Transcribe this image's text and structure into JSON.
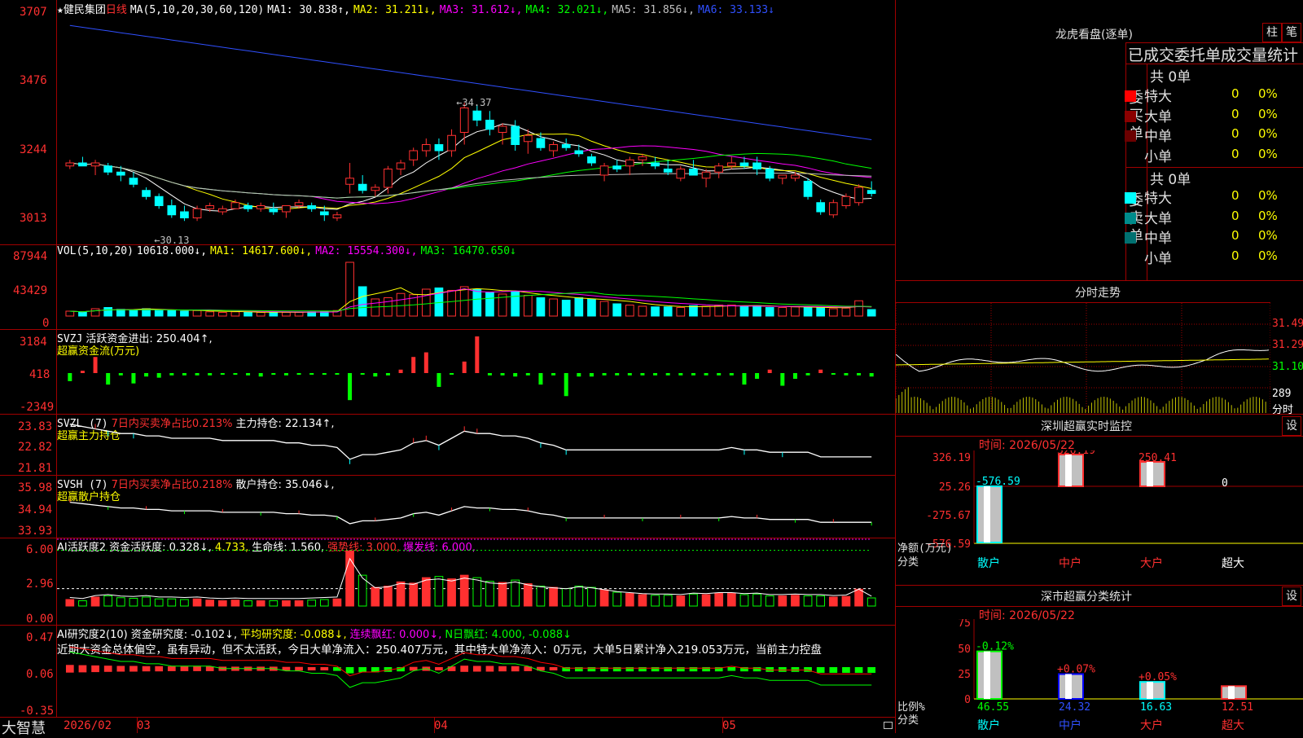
{
  "main_chart": {
    "star": "★",
    "stock_name": "健民集团",
    "period": "日线",
    "ma_params": "MA(5,10,20,30,60,120)",
    "ma1": "MA1: 30.838↑,",
    "ma2": "MA2: 31.211↓,",
    "ma3": "MA3: 31.612↓,",
    "ma4": "MA4: 32.021↓,",
    "ma5": "MA5: 31.856↓,",
    "ma6": "MA6: 33.133↓",
    "y_labels": [
      "3707",
      "3476",
      "3244",
      "3013"
    ],
    "high_mark": "34.37",
    "low_mark": "30.13"
  },
  "vol_panel": {
    "title": "VOL(5,10,20)",
    "value": "10618.000↓,",
    "ma1": "MA1: 14617.600↓,",
    "ma2": "MA2: 15554.300↓,",
    "ma3": "MA3: 16470.650↓",
    "y_labels": [
      "87944",
      "43429",
      "0"
    ]
  },
  "svzj_panel": {
    "title": "SVZJ",
    "desc": "活跃资金进出: 250.404↑,",
    "sub": "超赢资金流(万元)",
    "y_labels": [
      "3184",
      "418",
      "-2349"
    ]
  },
  "svzl_panel": {
    "title": "SVZL (7)",
    "desc": "7日内买卖净占比0.213%",
    "hold": "主力持仓: 22.134↑,",
    "sub": "超赢主力持仓",
    "y_labels": [
      "23.83",
      "22.82",
      "21.81"
    ]
  },
  "svsh_panel": {
    "title": "SVSH (7)",
    "desc": "7日内买卖净占比0.218%",
    "hold": "散户持仓: 35.046↓,",
    "sub": "超赢散户持仓",
    "y_labels": [
      "35.98",
      "34.94",
      "33.93"
    ]
  },
  "ai_active_panel": {
    "title": "AI活跃度2 资金活跃度: 0.328↓,",
    "v2": "4.733,",
    "life": "生命线: 1.560,",
    "strong": "强势线: 3.000,",
    "burst": "爆发线: 6.000,",
    "y_labels": [
      "6.00",
      "2.96",
      "0.00"
    ]
  },
  "ai_research_panel": {
    "title": "AI研究度2(10)",
    "fund": "资金研究度: -0.102↓,",
    "avg": "平均研究度: -0.088↓,",
    "cont": "连续飘红: 0.000↓,",
    "ndays": "N日飘红: 4.000, -0.088↓",
    "comment": "近期大资金总体偏空，虽有异动，但不太活跃，今日大单净流入：250.407万元，其中特大单净流入：0万元，大单5日累计净入219.053万元，当前主力控盘",
    "y_labels": [
      "0.47",
      "0.06",
      "-0.35"
    ]
  },
  "bottom_bar": {
    "brand": "大智慧",
    "dates": [
      "2026/02",
      "03",
      "04",
      "05"
    ]
  },
  "dragon_tiger": {
    "title": "龙虎看盘(逐单)",
    "btn_bar": "柱",
    "btn_tick": "笔",
    "stats_title": "已成交委托单成交量统计",
    "buy_label": "委买单",
    "sell_label": "委卖单",
    "buy_total": "共 0单",
    "sell_total": "共 0单",
    "buy_rows": [
      {
        "label": "特大",
        "count": "0",
        "pct": "0%",
        "color": "#ff0000"
      },
      {
        "label": "大单",
        "count": "0",
        "pct": "0%",
        "color": "#8b0000"
      },
      {
        "label": "中单",
        "count": "0",
        "pct": "0%",
        "color": "#6b0000"
      },
      {
        "label": "小单",
        "count": "0",
        "pct": "0%",
        "color": ""
      }
    ],
    "sell_rows": [
      {
        "label": "特大",
        "count": "0",
        "pct": "0%",
        "color": "#00ffff"
      },
      {
        "label": "大单",
        "count": "0",
        "pct": "0%",
        "color": "#008b8b"
      },
      {
        "label": "中单",
        "count": "0",
        "pct": "0%",
        "color": "#007070"
      },
      {
        "label": "小单",
        "count": "0",
        "pct": "0%",
        "color": ""
      }
    ]
  },
  "intraday": {
    "title": "分时走势",
    "price_labels": [
      "31.49",
      "31.29",
      "31.10"
    ],
    "vol_labels": [
      "289",
      "分时"
    ]
  },
  "sz_monitor": {
    "title": "深圳超赢实时监控",
    "btn": "设",
    "time": "时间: 2026/05/22",
    "y_labels": [
      "326.19",
      "25.26",
      "-275.67",
      "-576.59"
    ],
    "values": [
      "-576.59",
      "326.19",
      "250.41",
      "0"
    ],
    "axis_label": "净额(万元)",
    "cat_label": "分类",
    "cats": [
      "散户",
      "中户",
      "大户",
      "超大"
    ]
  },
  "sz_classify": {
    "title": "深市超赢分类统计",
    "btn": "设",
    "time": "时间: 2026/05/22",
    "y_labels": [
      "75",
      "50",
      "25",
      "0"
    ],
    "pct_labels": [
      "-0.12%",
      "+0.07%",
      "+0.05%",
      ""
    ],
    "values": [
      "46.55",
      "24.32",
      "16.63",
      "12.51"
    ],
    "axis_label": "比例%",
    "cat_label": "分类",
    "cats": [
      "散户",
      "中户",
      "大户",
      "超大"
    ]
  },
  "colors": {
    "up": "#ff3030",
    "down": "#00ffff",
    "ma1": "#ffffff",
    "ma2": "#ffff00",
    "ma3": "#ff00ff",
    "ma4": "#00ff00",
    "ma5": "#c0c0c0",
    "ma6": "#3050ff"
  },
  "chart_data": {
    "type": "candlestick",
    "title": "健民集团 日线",
    "x_labels": [
      "2026/02",
      "03",
      "04",
      "05"
    ],
    "ylim": [
      30.13,
      37.07
    ],
    "ohlc": [
      [
        32.3,
        32.5,
        32.2,
        32.4
      ],
      [
        32.4,
        32.6,
        32.3,
        32.3
      ],
      [
        32.3,
        32.5,
        32.0,
        32.4
      ],
      [
        32.3,
        32.4,
        32.0,
        32.1
      ],
      [
        32.1,
        32.3,
        31.8,
        32.0
      ],
      [
        31.9,
        32.1,
        31.6,
        31.7
      ],
      [
        31.5,
        31.6,
        31.2,
        31.3
      ],
      [
        31.3,
        31.4,
        30.9,
        31.0
      ],
      [
        31.0,
        31.2,
        30.6,
        30.7
      ],
      [
        30.8,
        31.0,
        30.5,
        30.6
      ],
      [
        30.6,
        31.0,
        30.5,
        30.9
      ],
      [
        30.9,
        31.1,
        30.8,
        31.0
      ],
      [
        30.8,
        31.0,
        30.7,
        30.9
      ],
      [
        30.9,
        31.2,
        30.9,
        31.1
      ],
      [
        31.0,
        31.1,
        30.8,
        30.9
      ],
      [
        30.9,
        31.1,
        30.8,
        31.0
      ],
      [
        30.9,
        31.1,
        30.7,
        30.8
      ],
      [
        30.8,
        31.0,
        30.6,
        31.0
      ],
      [
        31.0,
        31.2,
        30.9,
        31.1
      ],
      [
        31.0,
        31.1,
        30.8,
        30.9
      ],
      [
        30.8,
        31.0,
        30.5,
        30.7
      ],
      [
        30.6,
        30.8,
        30.5,
        30.7
      ],
      [
        31.7,
        32.4,
        31.4,
        31.9
      ],
      [
        31.7,
        32.0,
        31.4,
        31.5
      ],
      [
        31.5,
        31.7,
        31.3,
        31.6
      ],
      [
        31.6,
        32.3,
        31.4,
        32.2
      ],
      [
        32.2,
        32.5,
        32.0,
        32.4
      ],
      [
        32.5,
        32.9,
        32.3,
        32.8
      ],
      [
        32.8,
        33.2,
        32.6,
        33.0
      ],
      [
        33.0,
        33.2,
        32.5,
        32.8
      ],
      [
        32.8,
        33.5,
        32.6,
        33.3
      ],
      [
        33.4,
        34.37,
        33.0,
        34.2
      ],
      [
        34.1,
        34.3,
        33.6,
        33.8
      ],
      [
        33.8,
        34.1,
        33.3,
        33.5
      ],
      [
        33.4,
        33.7,
        33.0,
        33.6
      ],
      [
        33.6,
        33.8,
        32.8,
        33.0
      ],
      [
        33.1,
        33.5,
        32.7,
        33.3
      ],
      [
        33.2,
        33.4,
        32.8,
        32.9
      ],
      [
        32.8,
        33.1,
        32.6,
        33.0
      ],
      [
        33.0,
        33.2,
        32.8,
        32.9
      ],
      [
        32.8,
        33.0,
        32.6,
        32.7
      ],
      [
        32.6,
        32.7,
        32.3,
        32.4
      ],
      [
        32.0,
        32.4,
        31.8,
        32.3
      ],
      [
        32.3,
        32.5,
        32.1,
        32.2
      ],
      [
        32.3,
        32.6,
        32.0,
        32.5
      ],
      [
        32.5,
        32.7,
        32.3,
        32.6
      ],
      [
        32.4,
        32.6,
        32.2,
        32.3
      ],
      [
        32.2,
        32.5,
        32.0,
        32.1
      ],
      [
        31.9,
        32.3,
        31.8,
        32.2
      ],
      [
        32.2,
        32.5,
        32.0,
        32.0
      ],
      [
        31.9,
        32.2,
        31.6,
        32.1
      ],
      [
        32.1,
        32.4,
        31.9,
        32.3
      ],
      [
        32.3,
        32.6,
        32.2,
        32.4
      ],
      [
        32.4,
        32.6,
        32.2,
        32.3
      ],
      [
        32.4,
        32.6,
        32.0,
        32.2
      ],
      [
        32.2,
        32.3,
        31.8,
        31.9
      ],
      [
        31.9,
        32.0,
        31.7,
        32.0
      ],
      [
        31.9,
        32.1,
        31.8,
        32.0
      ],
      [
        31.8,
        31.9,
        31.2,
        31.3
      ],
      [
        31.1,
        31.2,
        30.7,
        30.8
      ],
      [
        30.7,
        31.2,
        30.6,
        31.1
      ],
      [
        31.0,
        31.4,
        30.9,
        31.3
      ],
      [
        31.1,
        31.7,
        31.0,
        31.6
      ],
      [
        31.5,
        31.8,
        31.3,
        31.4
      ]
    ],
    "volume": [
      8000,
      6000,
      12000,
      14000,
      11000,
      10000,
      12000,
      9000,
      9000,
      8000,
      9000,
      7000,
      6000,
      7000,
      6000,
      6000,
      6000,
      6000,
      6000,
      7000,
      8000,
      9000,
      87944,
      48000,
      28000,
      30000,
      37000,
      35000,
      44000,
      46000,
      42000,
      48000,
      44000,
      38000,
      36000,
      40000,
      34000,
      30000,
      28000,
      26000,
      30000,
      28000,
      24000,
      20000,
      18000,
      16000,
      15000,
      15000,
      14000,
      17000,
      16000,
      18000,
      18000,
      16000,
      17000,
      14000,
      14000,
      15000,
      14000,
      14000,
      12000,
      13000,
      25000,
      10618
    ],
    "svzj": [
      -700,
      200,
      1400,
      -1000,
      -200,
      -900,
      -300,
      -400,
      -200,
      -200,
      -200,
      -200,
      -150,
      -150,
      -200,
      -300,
      -150,
      -200,
      -150,
      -150,
      -150,
      -100,
      -2349,
      -100,
      -300,
      -200,
      300,
      1400,
      1800,
      -1200,
      -100,
      1000,
      3184,
      -200,
      -200,
      -300,
      -200,
      -1000,
      -200,
      -2000,
      -300,
      -300,
      -200,
      -200,
      -200,
      -200,
      -200,
      -200,
      -200,
      -200,
      -200,
      -200,
      -200,
      -1000,
      -500,
      300,
      -1100,
      -500,
      -200,
      300,
      -100,
      -200,
      -200,
      -300
    ],
    "svzl": [
      23.7,
      23.6,
      23.5,
      23.4,
      23.3,
      23.3,
      23.2,
      23.2,
      23.1,
      23.1,
      23.1,
      23.1,
      23.0,
      23.0,
      23.0,
      23.0,
      23.0,
      22.9,
      22.9,
      22.8,
      22.8,
      22.7,
      22.2,
      22.4,
      22.4,
      22.5,
      22.6,
      22.9,
      23.0,
      22.8,
      23.1,
      23.4,
      23.3,
      23.3,
      23.2,
      23.2,
      23.1,
      22.9,
      22.8,
      22.6,
      22.6,
      22.6,
      22.6,
      22.6,
      22.6,
      22.6,
      22.6,
      22.6,
      22.6,
      22.6,
      22.6,
      22.6,
      22.7,
      22.6,
      22.6,
      22.5,
      22.5,
      22.5,
      22.5,
      22.3,
      22.3,
      22.3,
      22.3,
      22.3
    ]
  }
}
